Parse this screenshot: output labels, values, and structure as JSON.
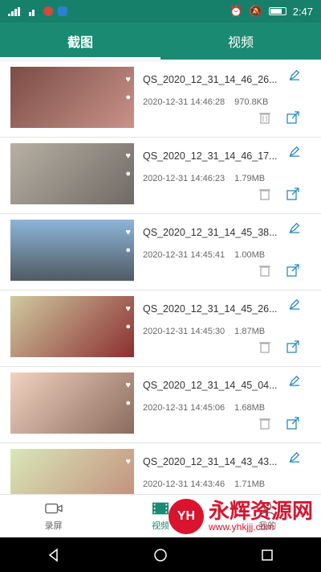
{
  "status_bar": {
    "time": "2:47"
  },
  "tabs": [
    {
      "label": "截图"
    },
    {
      "label": "视频"
    }
  ],
  "items": [
    {
      "title": "QS_2020_12_31_14_46_26...",
      "date": "2020-12-31 14:46:28",
      "size": "970.8KB"
    },
    {
      "title": "QS_2020_12_31_14_46_17...",
      "date": "2020-12-31 14:46:23",
      "size": "1.79MB"
    },
    {
      "title": "QS_2020_12_31_14_45_38...",
      "date": "2020-12-31 14:45:41",
      "size": "1.00MB"
    },
    {
      "title": "QS_2020_12_31_14_45_26...",
      "date": "2020-12-31 14:45:30",
      "size": "1.87MB"
    },
    {
      "title": "QS_2020_12_31_14_45_04...",
      "date": "2020-12-31 14:45:06",
      "size": "1.68MB"
    },
    {
      "title": "QS_2020_12_31_14_43_43...",
      "date": "2020-12-31 14:43:46",
      "size": "1.71MB"
    }
  ],
  "bottom_nav": [
    {
      "label": "录屏"
    },
    {
      "label": "视频"
    },
    {
      "label": "我的"
    }
  ],
  "watermark": {
    "logo": "YH",
    "name": "永辉资源网",
    "url": "www.yhkjjj.com"
  },
  "colors": {
    "primary": "#1b8a72",
    "accent": "#2a8bbf"
  }
}
